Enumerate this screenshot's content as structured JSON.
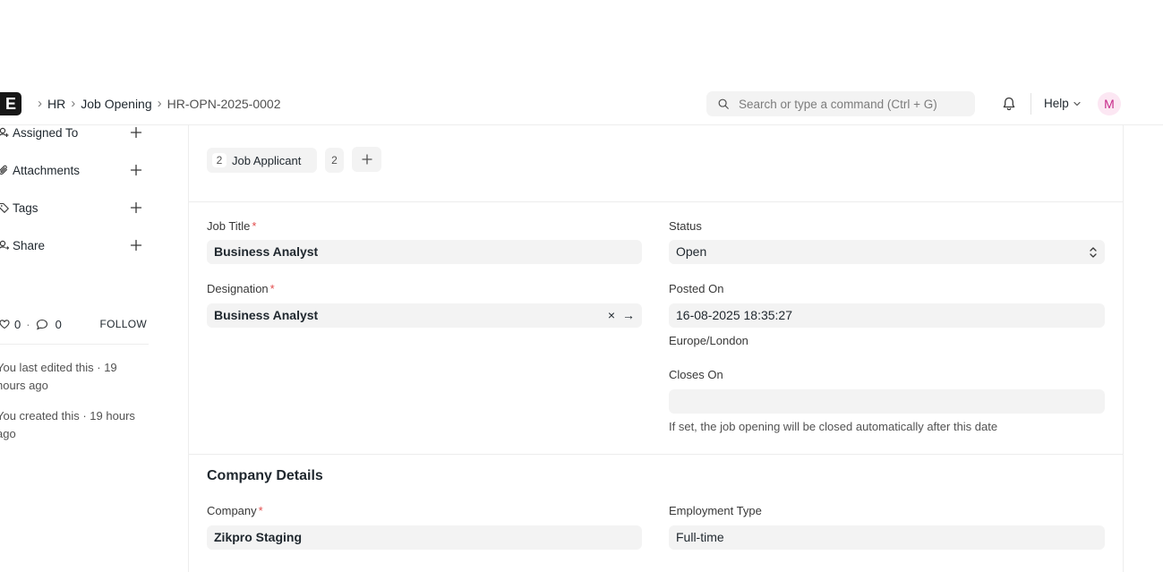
{
  "app": {
    "logo_letter": "E"
  },
  "breadcrumb": [
    "HR",
    "Job Opening",
    "HR-OPN-2025-0002"
  ],
  "search": {
    "placeholder": "Search or type a command (Ctrl + G)"
  },
  "navbar": {
    "help_label": "Help",
    "avatar_initial": "M",
    "avatar_color": "#c72a8a"
  },
  "sidebar": {
    "items": [
      {
        "label": "Assigned To",
        "icon": "user-plus-icon"
      },
      {
        "label": "Attachments",
        "icon": "paperclip-icon"
      },
      {
        "label": "Tags",
        "icon": "tag-icon"
      },
      {
        "label": "Share",
        "icon": "share-user-icon"
      }
    ],
    "likes": "0",
    "comments": "0",
    "dot": "·",
    "follow_label": "FOLLOW",
    "last_edited": "You last edited this · 19 hours ago",
    "created": "You created this · 19 hours ago"
  },
  "connections": {
    "count_left": "2",
    "label": "Job Applicant",
    "count_right": "2"
  },
  "form": {
    "job_title": {
      "label": "Job Title",
      "required": "*",
      "value": "Business Analyst"
    },
    "status": {
      "label": "Status",
      "value": "Open"
    },
    "designation": {
      "label": "Designation",
      "required": "*",
      "value": "Business Analyst",
      "clear": "×",
      "link": "→"
    },
    "posted_on": {
      "label": "Posted On",
      "value": "16-08-2025 18:35:27",
      "timezone": "Europe/London"
    },
    "closes_on": {
      "label": "Closes On",
      "value": "",
      "help": "If set, the job opening will be closed automatically after this date"
    }
  },
  "company_section": {
    "title": "Company Details",
    "company": {
      "label": "Company",
      "required": "*",
      "value": "Zikpro Staging"
    },
    "employment_type": {
      "label": "Employment Type",
      "value": "Full-time"
    }
  }
}
